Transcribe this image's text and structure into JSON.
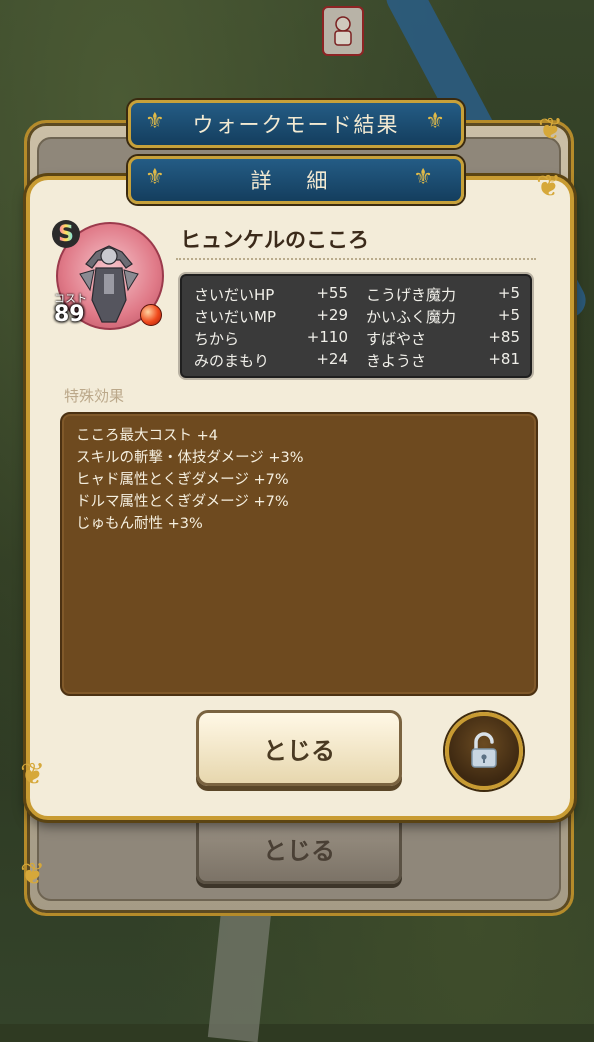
{
  "back_panel": {
    "banner_title": "ウォークモード結果",
    "close_label": "とじる"
  },
  "detail_panel": {
    "banner_title": "詳 細",
    "rank": "S",
    "cost_label": "コスト",
    "cost_value": "89",
    "kokoro_name": "ヒュンケルのこころ",
    "stats": [
      {
        "name": "さいだいHP",
        "value": "+55"
      },
      {
        "name": "こうげき魔力",
        "value": "+5"
      },
      {
        "name": "さいだいMP",
        "value": "+29"
      },
      {
        "name": "かいふく魔力",
        "value": "+5"
      },
      {
        "name": "ちから",
        "value": "+110"
      },
      {
        "name": "すばやさ",
        "value": "+85"
      },
      {
        "name": "みのまもり",
        "value": "+24"
      },
      {
        "name": "きようさ",
        "value": "+81"
      }
    ],
    "special_title": "特殊効果",
    "effects": [
      "こころ最大コスト +4",
      "スキルの斬撃・体技ダメージ +3%",
      "ヒャド属性とくぎダメージ +7%",
      "ドルマ属性とくぎダメージ +7%",
      "じゅもん耐性 +3%"
    ],
    "close_label": "とじる"
  },
  "icons": {
    "lock": "unlock-icon",
    "orb": "fire-orb-icon",
    "corner": "ornament-icon"
  }
}
